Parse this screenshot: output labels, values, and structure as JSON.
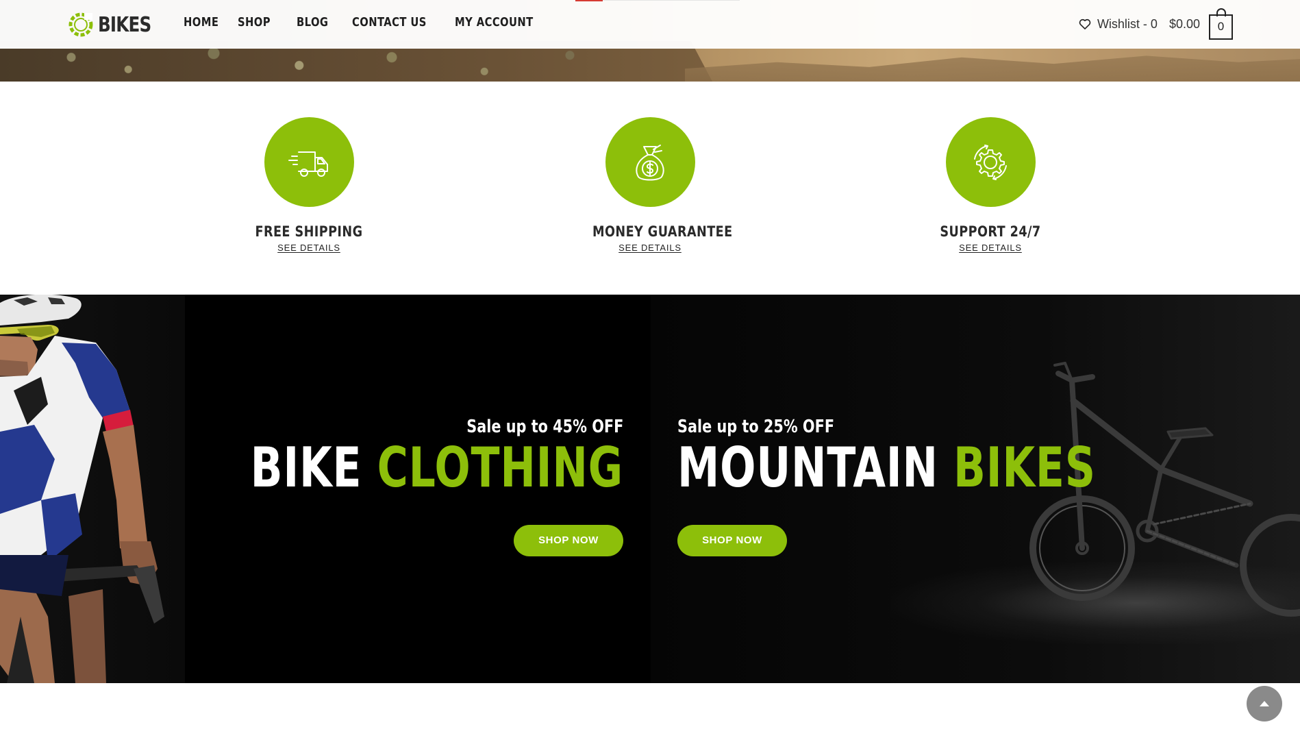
{
  "brand": {
    "name": "BIKES",
    "accent_color": "#8dbf0a"
  },
  "nav": {
    "items": [
      {
        "label": "HOME"
      },
      {
        "label": "SHOP"
      },
      {
        "label": "BLOG"
      },
      {
        "label": "CONTACT US"
      },
      {
        "label": "MY ACCOUNT"
      }
    ]
  },
  "header": {
    "wishlist_label": "Wishlist - 0",
    "cart_total": "$0.00",
    "cart_count": "0"
  },
  "features": [
    {
      "title": "FREE SHIPPING",
      "link": "SEE DETAILS",
      "icon": "delivery-truck-icon"
    },
    {
      "title": "MONEY GUARANTEE",
      "link": "SEE DETAILS",
      "icon": "money-bag-icon"
    },
    {
      "title": "SUPPORT 24/7",
      "link": "SEE DETAILS",
      "icon": "gear-support-icon"
    }
  ],
  "promos": [
    {
      "sale": "Sale up to 45% OFF",
      "word1": "BIKE",
      "word2": "CLOTHING",
      "button": "SHOP NOW"
    },
    {
      "sale": "Sale up to 25% OFF",
      "word1": "MOUNTAIN",
      "word2": "BIKES",
      "button": "SHOP NOW"
    }
  ]
}
